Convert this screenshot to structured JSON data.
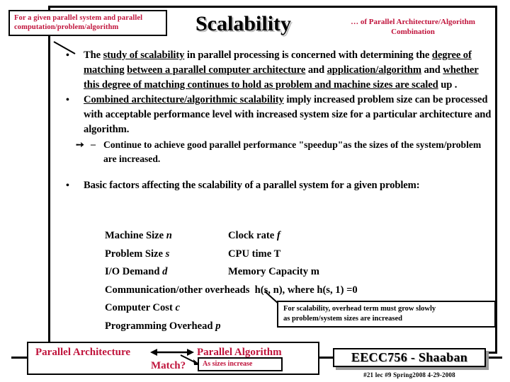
{
  "header": {
    "given_box": {
      "line1": "For a given parallel system and parallel",
      "line2": "computation/problem/algorithm"
    },
    "title": "Scalability",
    "subtitle_line1": "… of  Parallel Architecture/Algorithm",
    "subtitle_line2": "Combination"
  },
  "bullets": {
    "b1": {
      "marker": "•",
      "seg1": "The ",
      "seg2_u": "study of scalability",
      "seg3": " in parallel processing is concerned with determining the ",
      "seg4_u": "degree of matching",
      "seg5": " ",
      "seg6_u": "between a parallel computer architecture",
      "seg7": " and ",
      "seg8_u": "application/algorithm",
      "seg9": " and ",
      "seg10_u": "whether this degree of matching continues to hold as problem and machine sizes are scaled",
      "seg11": " up ."
    },
    "b2": {
      "marker": "•",
      "seg1_u": "Combined architecture/algorithmic scalability",
      "seg2": " imply  increased problem size can be processed with acceptable performance level with increased system size for a particular architecture and algorithm."
    },
    "sub1": {
      "arrow": "➙",
      "dash": "–",
      "text": "Continue to achieve good parallel performance \"speedup\"as the sizes of the system/problem are increased."
    },
    "b3": {
      "marker": "•",
      "text": "Basic factors affecting the scalability of a parallel system for a given problem:"
    }
  },
  "factors": [
    {
      "left_label": "Machine Size ",
      "left_var": "n",
      "right_label": "Clock rate ",
      "right_var": "f"
    },
    {
      "left_label": "Problem Size ",
      "left_var": "s",
      "right_label": "CPU time  T",
      "right_var": ""
    },
    {
      "left_label": "I/O Demand ",
      "left_var": "d",
      "right_label": "Memory Capacity  m",
      "right_var": ""
    },
    {
      "left_label": "Communication/other overheads",
      "left_var": "",
      "right_label": "h(s, n),  where  h(s, 1) =0",
      "right_var": ""
    },
    {
      "left_label": "Computer Cost ",
      "left_var": "c",
      "right_label": "",
      "right_var": ""
    },
    {
      "left_label": "Programming Overhead ",
      "left_var": "p",
      "right_label": "",
      "right_var": ""
    }
  ],
  "note_box": {
    "line1": "For scalability, overhead term must grow slowly",
    "line2": "as  problem/system sizes are increased"
  },
  "match_box": {
    "architecture": "Parallel Architecture",
    "algorithm": "Parallel Algorithm",
    "question": "Match?",
    "sizes_note": "As sizes increase"
  },
  "signature": {
    "title": "EECC756 - Shaaban",
    "footer": "#21  lec #9   Spring2008  4-29-2008"
  },
  "colors": {
    "accent_red": "#c0143c",
    "frame_black": "#000000",
    "shadow_gray": "#9a9a9a"
  }
}
